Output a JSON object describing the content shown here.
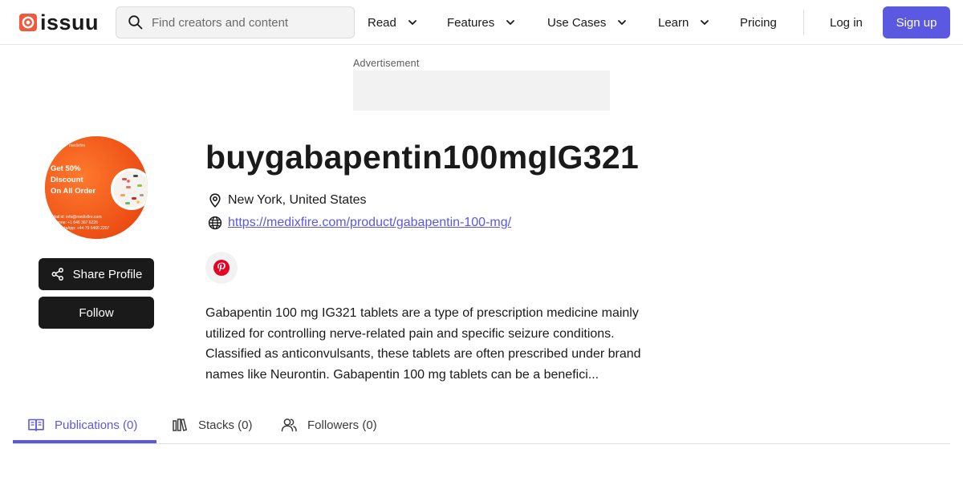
{
  "header": {
    "logo_text": "issuu",
    "search_placeholder": "Find creators and content",
    "nav": [
      {
        "label": "Read",
        "has_dropdown": true
      },
      {
        "label": "Features",
        "has_dropdown": true
      },
      {
        "label": "Use Cases",
        "has_dropdown": true
      },
      {
        "label": "Learn",
        "has_dropdown": true
      },
      {
        "label": "Pricing",
        "has_dropdown": false
      }
    ],
    "login_label": "Log in",
    "signup_label": "Sign up"
  },
  "ad": {
    "label": "Advertisement"
  },
  "avatar": {
    "text_lines": [
      "Get 50%",
      "Discount",
      "On All Order"
    ],
    "contact_lines": [
      "Mail id: info@medixfire.com",
      "Phone: +1 646 367 6226",
      "WhatsApp: +44 79 5466 2207"
    ]
  },
  "profile": {
    "title": "buygabapentin100mgIG321",
    "location": "New York, United States",
    "website": "https://medixfire.com/product/gabapentin-100-mg/",
    "bio": "Gabapentin 100 mg IG321 tablets are a type of prescription medicine mainly utilized for controlling nerve-related pain and specific seizure conditions. Classified as anticonvulsants, these tablets are often prescribed under brand names like Neurontin. Gabapentin 100 mg tablets can be a benefici..."
  },
  "buttons": {
    "share_label": "Share Profile",
    "follow_label": "Follow"
  },
  "tabs": [
    {
      "label": "Publications (0)",
      "active": true
    },
    {
      "label": "Stacks (0)",
      "active": false
    },
    {
      "label": "Followers (0)",
      "active": false
    }
  ],
  "colors": {
    "accent": "#5b58e1",
    "dark_button": "#1a1a1a",
    "logo_red": "#f05a3c",
    "pinterest_red": "#e60023",
    "avatar_orange": "#f05a1e"
  }
}
